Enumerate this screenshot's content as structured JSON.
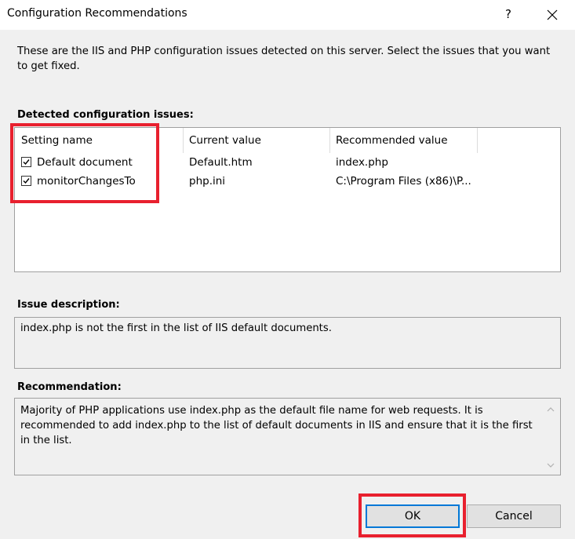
{
  "dialog": {
    "title": "Configuration Recommendations",
    "help_label": "?",
    "intro": "These are the IIS and PHP configuration issues detected on this server. Select the issues that you want to get fixed."
  },
  "issues": {
    "label": "Detected configuration issues:",
    "columns": [
      "Setting name",
      "Current value",
      "Recommended value"
    ],
    "rows": [
      {
        "checked": true,
        "setting": "Default document",
        "current": "Default.htm",
        "recommended": "index.php"
      },
      {
        "checked": true,
        "setting": "monitorChangesTo",
        "current": "php.ini",
        "recommended": "C:\\Program Files (x86)\\P..."
      }
    ]
  },
  "description": {
    "label": "Issue description:",
    "text": "index.php is not the first in the list of IIS default documents."
  },
  "recommendation": {
    "label": "Recommendation:",
    "text": "Majority of PHP applications use index.php as the default file name for web requests. It is recommended to add index.php to the list of default documents in IIS and ensure that it is the first in the list."
  },
  "buttons": {
    "ok": "OK",
    "cancel": "Cancel"
  },
  "icons": {
    "help": "help-icon",
    "close": "close-icon",
    "check": "checkmark-icon",
    "scroll_up": "chevron-up-icon",
    "scroll_down": "chevron-down-icon"
  },
  "colors": {
    "highlight": "#e8202e",
    "focus": "#0078d7"
  }
}
